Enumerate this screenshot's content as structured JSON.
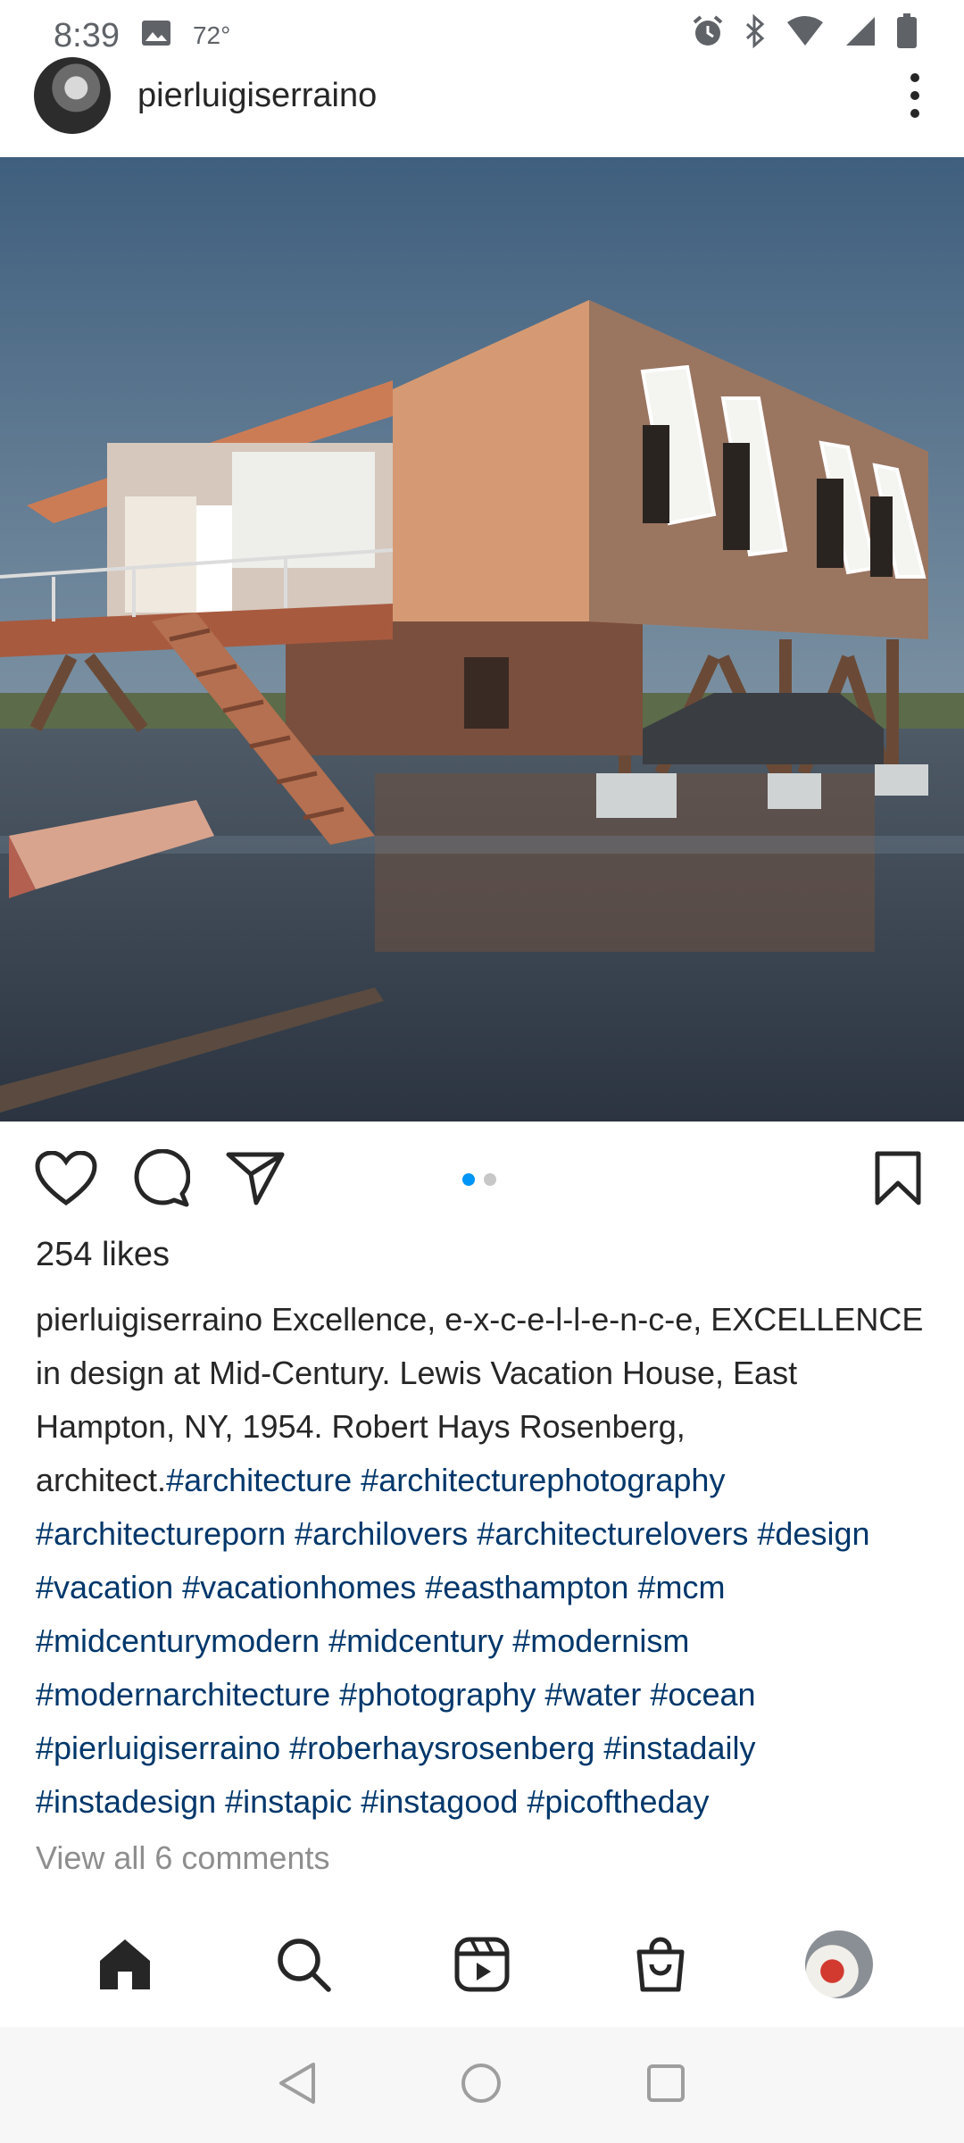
{
  "status_bar": {
    "time": "8:39",
    "temperature": "72°",
    "icons": [
      "image-icon",
      "alarm-icon",
      "bluetooth-icon",
      "wifi-icon",
      "signal-icon",
      "battery-icon"
    ]
  },
  "post": {
    "username": "pierluigiserraino",
    "likes": "254 likes",
    "caption_user": "pierluigiserraino",
    "caption_text": " Excellence, e-x-c-e-l-l-e-n-c-e, EXCELLENCE in design at Mid-Century. Lewis Vacation House, East Hampton, NY, 1954. Robert Hays Rosenberg, architect.",
    "hashtags": "#architecture #architecturephotography #architectureporn #archilovers #architecturelovers #design #vacation #vacationhomes #easthampton #mcm #midcenturymodern #midcentury #modernism #modernarchitecture #photography #water #ocean #pierluigiserraino #roberhaysrosenberg #instadaily #instadesign #instapic #instagood #picoftheday",
    "view_comments": "View all 6 comments",
    "carousel": {
      "count": 2,
      "active": 1
    }
  },
  "colors": {
    "hashtag": "#00376b",
    "dot_active": "#0095f6",
    "muted": "#8e8e8e"
  },
  "bottom_nav": [
    "home-icon",
    "search-icon",
    "reels-icon",
    "shop-icon",
    "profile-avatar"
  ],
  "system_nav": [
    "back-button",
    "home-button",
    "recents-button"
  ]
}
